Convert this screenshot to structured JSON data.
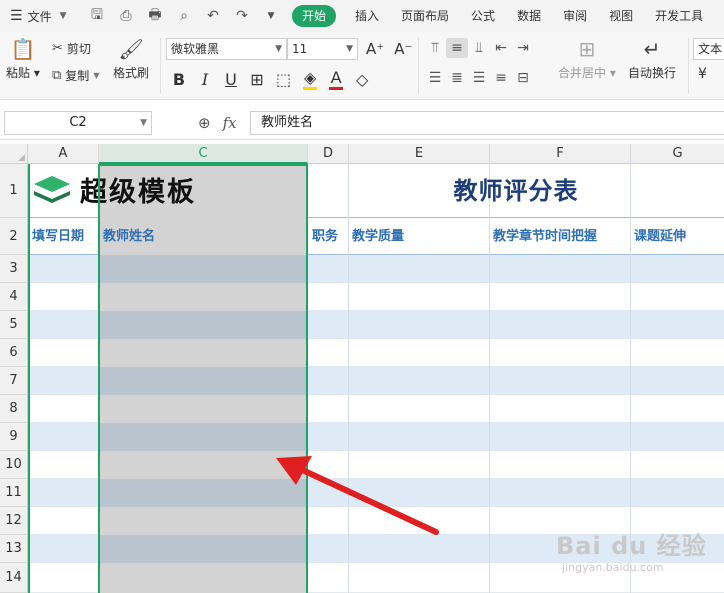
{
  "menu": {
    "file_label": "文件",
    "tabs": [
      {
        "label": "开始",
        "active": true
      },
      {
        "label": "插入"
      },
      {
        "label": "页面布局"
      },
      {
        "label": "公式"
      },
      {
        "label": "数据"
      },
      {
        "label": "审阅"
      },
      {
        "label": "视图"
      },
      {
        "label": "开发工具"
      }
    ],
    "quick_access_icons": [
      "save-icon",
      "print-preview-icon",
      "print-icon",
      "find-icon",
      "undo-icon",
      "redo-icon",
      "chevron-down-icon"
    ]
  },
  "ribbon": {
    "paste": "粘贴",
    "cut": "剪切",
    "copy": "复制",
    "format_painter": "格式刷",
    "font_name": "微软雅黑",
    "font_size": "11",
    "merge_center": "合并居中",
    "wrap_text": "自动换行",
    "number_format": "文本",
    "currency_symbol": "¥"
  },
  "formula_bar": {
    "name_box": "C2",
    "content": "教师姓名"
  },
  "sheet": {
    "columns": [
      {
        "label": "A"
      },
      {
        "label": "C",
        "selected": true
      },
      {
        "label": "D"
      },
      {
        "label": "E"
      },
      {
        "label": "F"
      },
      {
        "label": "G"
      }
    ],
    "rows": [
      "1",
      "2",
      "3",
      "4",
      "5",
      "6",
      "7",
      "8",
      "9",
      "10",
      "11",
      "12",
      "13",
      "14"
    ],
    "logo_text": "超级模板",
    "title": "教师评分表",
    "headers": {
      "a": "填写日期",
      "c": "教师姓名",
      "d": "职务",
      "e": "教学质量",
      "f": "教学章节时间把握",
      "g": "课题延伸"
    }
  },
  "watermark": {
    "line1": "Bai du 经验",
    "line2": "jingyan.baidu.com"
  },
  "colors": {
    "accent_green": "#21a366",
    "title_blue": "#1d3e78",
    "header_blue": "#2f6fb3",
    "band_blue": "#deeaf6",
    "arrow_red": "#e02020"
  }
}
